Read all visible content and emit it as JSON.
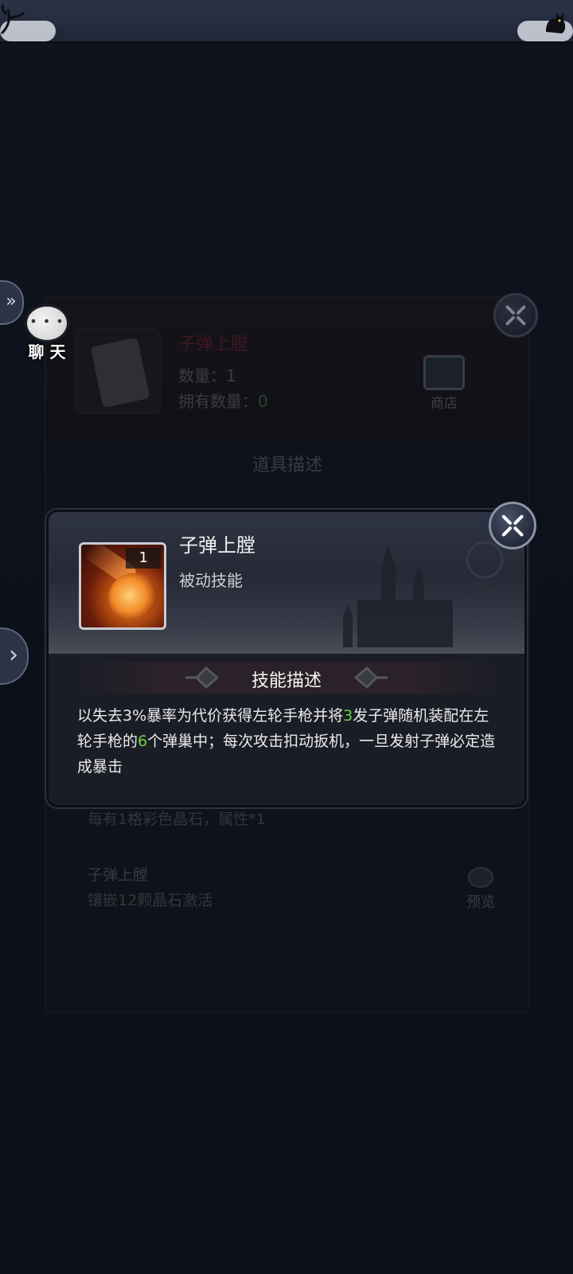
{
  "background_panel": {
    "item_name": "子弹上膛",
    "quantity_label": "数量：",
    "quantity_value": "1",
    "owned_label": "拥有数量：",
    "owned_value": "0",
    "shop_label": "商店",
    "tab_label": "道具描述",
    "stat_line": "每有1格彩色晶石，属性*1",
    "skill_name": "子弹上膛",
    "inlay_prefix": "镶嵌",
    "inlay_value": "12",
    "inlay_suffix": "颗晶石激活",
    "preview_label": "预览"
  },
  "chat": {
    "label": "聊 天",
    "icon": "chat-bubble-icon"
  },
  "popup": {
    "skill_name": "子弹上膛",
    "skill_type": "被动技能",
    "skill_level": "1",
    "section_title": "技能描述",
    "description": {
      "part1": "以失去3%暴率为代价获得左轮手枪并将",
      "num1": "3",
      "part2": "发子弹随机装配在左轮手枪的",
      "num2": "6",
      "part3": "个弹巢中；每次攻击扣动扳机，一旦发射子弹必定造成暴击"
    },
    "highlight_color": "#66d24a"
  },
  "icons": {
    "close": "close-icon",
    "side_tab": "double-chevron-right-icon",
    "expand_tab": "chevron-right-icon"
  }
}
